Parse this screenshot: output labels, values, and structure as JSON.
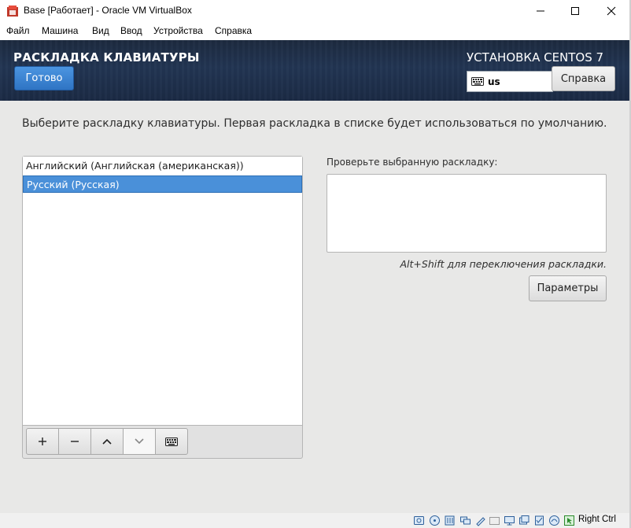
{
  "window": {
    "title": "Base [Работает] - Oracle VM VirtualBox",
    "icon": "virtualbox-icon",
    "controls": [
      "minimize-icon",
      "maximize-icon",
      "close-icon"
    ]
  },
  "menu": [
    "Файл",
    "Машина",
    "Вид",
    "Ввод",
    "Устройства",
    "Справка"
  ],
  "header": {
    "title": "РАСКЛАДКА КЛАВИАТУРЫ",
    "done_label": "Готово",
    "product": "УСТАНОВКА CENTOS 7",
    "keyboard_indicator": "us",
    "help_label": "Справка",
    "accent": "#3b84d2"
  },
  "content": {
    "instruction": "Выберите раскладку клавиатуры. Первая раскладка в списке будет использоваться по умолчанию.",
    "layouts": [
      {
        "label": "Английский (Английская (американская))",
        "selected": false
      },
      {
        "label": "Русский (Русская)",
        "selected": true
      }
    ],
    "toolbar": [
      "add-icon",
      "remove-icon",
      "move-up-icon",
      "move-down-icon",
      "keyboard-icon"
    ],
    "test_label": "Проверьте выбранную раскладку:",
    "test_value": "",
    "switch_hint": "Alt+Shift для переключения раскладки.",
    "options_label": "Параметры"
  },
  "statusbar": {
    "host_key": "Right Ctrl"
  }
}
